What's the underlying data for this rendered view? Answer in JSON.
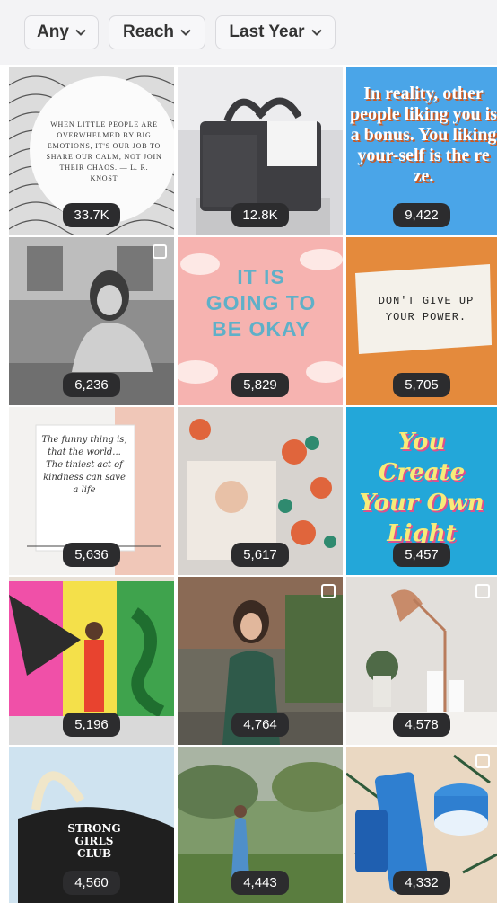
{
  "filters": [
    {
      "label": "Any"
    },
    {
      "label": "Reach"
    },
    {
      "label": "Last Year"
    }
  ],
  "posts": [
    {
      "metric": "33.7K",
      "text": "WHEN LITTLE PEOPLE ARE OVERWHELMED BY BIG EMOTIONS, IT'S OUR JOB TO SHARE OUR CALM, NOT JOIN THEIR CHAOS. — L. R. KNOST"
    },
    {
      "metric": "12.8K"
    },
    {
      "metric": "9,422",
      "text": "In reality, other people liking you is a bonus. You liking your-self is the re ze."
    },
    {
      "metric": "6,236"
    },
    {
      "metric": "5,829",
      "text": "IT IS GOING TO BE OKAY"
    },
    {
      "metric": "5,705",
      "text": "DON'T GIVE UP YOUR POWER."
    },
    {
      "metric": "5,636",
      "text": "The funny thing is, that the world... The tiniest act of kindness can save a life"
    },
    {
      "metric": "5,617"
    },
    {
      "metric": "5,457",
      "text": "You Create Your Own Light"
    },
    {
      "metric": "5,196"
    },
    {
      "metric": "4,764"
    },
    {
      "metric": "4,578"
    },
    {
      "metric": "4,560",
      "text": "STRONG GIRLS CLUB"
    },
    {
      "metric": "4,443"
    },
    {
      "metric": "4,332"
    }
  ],
  "colors": {
    "badge": "#2c2c2e",
    "quote_blue": "#4aa5e8",
    "quote_orange": "#c75b28",
    "pink": "#f6b3b0",
    "teal": "#23a7d9"
  }
}
